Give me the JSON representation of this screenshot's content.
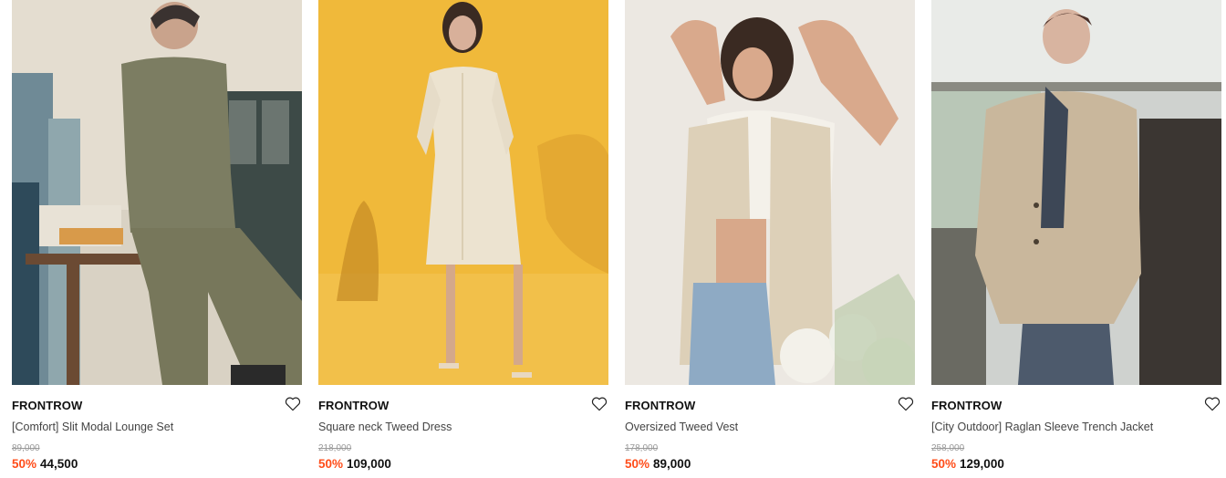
{
  "products": [
    {
      "brand": "FRONTROW",
      "name": "[Comfort] Slit Modal Lounge Set",
      "original_price": "89,000",
      "discount": "50%",
      "sale_price": "44,500",
      "image_description": "model in olive modal lounge set sitting on wooden stool",
      "wishlist_icon": "heart-outline-icon"
    },
    {
      "brand": "FRONTROW",
      "name": "Square neck Tweed Dress",
      "original_price": "218,000",
      "discount": "50%",
      "sale_price": "109,000",
      "image_description": "model in cream tweed dress against yellow backdrop",
      "wishlist_icon": "heart-outline-icon"
    },
    {
      "brand": "FRONTROW",
      "name": "Oversized Tweed Vest",
      "original_price": "178,000",
      "discount": "50%",
      "sale_price": "89,000",
      "image_description": "model in tweed vest and jeans with white flowers",
      "wishlist_icon": "heart-outline-icon"
    },
    {
      "brand": "FRONTROW",
      "name": "[City Outdoor] Raglan Sleeve Trench Jacket",
      "original_price": "258,000",
      "discount": "50%",
      "sale_price": "129,000",
      "image_description": "model in beige trench jacket in interior room",
      "wishlist_icon": "heart-outline-icon"
    }
  ],
  "colors": {
    "discount": "#ff4d1a",
    "text": "#111111",
    "muted": "#999999"
  }
}
